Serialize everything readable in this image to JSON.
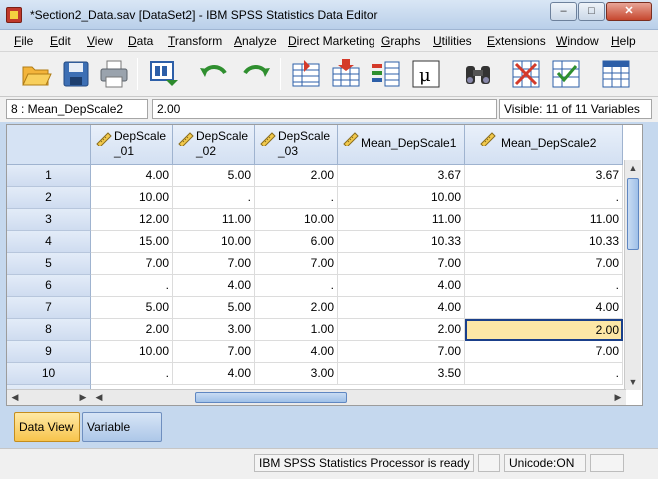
{
  "window": {
    "title": "*Section2_Data.sav [DataSet2] - IBM SPSS Statistics Data Editor",
    "controls": {
      "minimize": "–",
      "maximize": "□",
      "close": "✕"
    }
  },
  "menu": [
    "File",
    "Edit",
    "View",
    "Data",
    "Transform",
    "Analyze",
    "Direct Marketing",
    "Graphs",
    "Utilities",
    "Extensions",
    "Window",
    "Help"
  ],
  "toolbar": {
    "buttons": [
      "open-icon",
      "save-icon",
      "print-icon",
      "dialog-recall-icon",
      "undo-icon",
      "redo-icon",
      "go-to-case-icon",
      "go-to-variable-icon",
      "variables-icon",
      "value-labels-icon",
      "find-icon",
      "split-file-icon",
      "select-cases-icon",
      "use-variable-sets-icon"
    ]
  },
  "cell_editor": {
    "cell_reference": "8 : Mean_DepScale2",
    "cell_value": "2.00",
    "visible_status": "Visible: 11 of 11 Variables"
  },
  "grid": {
    "columns": [
      {
        "name": "DepScale_01",
        "header": "DepScale\n_01"
      },
      {
        "name": "DepScale_02",
        "header": "DepScale\n_02"
      },
      {
        "name": "DepScale_03",
        "header": "DepScale\n_03"
      },
      {
        "name": "Mean_DepScale1",
        "header": "Mean_DepScale1"
      },
      {
        "name": "Mean_DepScale2",
        "header": "Mean_DepScale2"
      }
    ],
    "rows": [
      {
        "id": "1",
        "values": [
          "4.00",
          "5.00",
          "2.00",
          "3.67",
          "3.67"
        ]
      },
      {
        "id": "2",
        "values": [
          "10.00",
          ".",
          ".",
          "10.00",
          "."
        ]
      },
      {
        "id": "3",
        "values": [
          "12.00",
          "11.00",
          "10.00",
          "11.00",
          "11.00"
        ]
      },
      {
        "id": "4",
        "values": [
          "15.00",
          "10.00",
          "6.00",
          "10.33",
          "10.33"
        ]
      },
      {
        "id": "5",
        "values": [
          "7.00",
          "7.00",
          "7.00",
          "7.00",
          "7.00"
        ]
      },
      {
        "id": "6",
        "values": [
          ".",
          "4.00",
          ".",
          "4.00",
          "."
        ]
      },
      {
        "id": "7",
        "values": [
          "5.00",
          "5.00",
          "2.00",
          "4.00",
          "4.00"
        ]
      },
      {
        "id": "8",
        "values": [
          "2.00",
          "3.00",
          "1.00",
          "2.00",
          "2.00"
        ]
      },
      {
        "id": "9",
        "values": [
          "10.00",
          "7.00",
          "4.00",
          "7.00",
          "7.00"
        ]
      },
      {
        "id": "10",
        "values": [
          ".",
          "4.00",
          "3.00",
          "3.50",
          "."
        ]
      }
    ],
    "selected_cell": {
      "row": "8",
      "column": "Mean_DepScale2"
    }
  },
  "tabs": {
    "data_view": "Data View",
    "variable_view": "Variable View"
  },
  "status": {
    "processor": "IBM SPSS Statistics Processor is ready",
    "encoding": "Unicode:ON"
  },
  "colors": {
    "selected_cell": "#fde7a6",
    "active_tab": "#f7c44c",
    "header_blue": "#d3e0f2"
  }
}
